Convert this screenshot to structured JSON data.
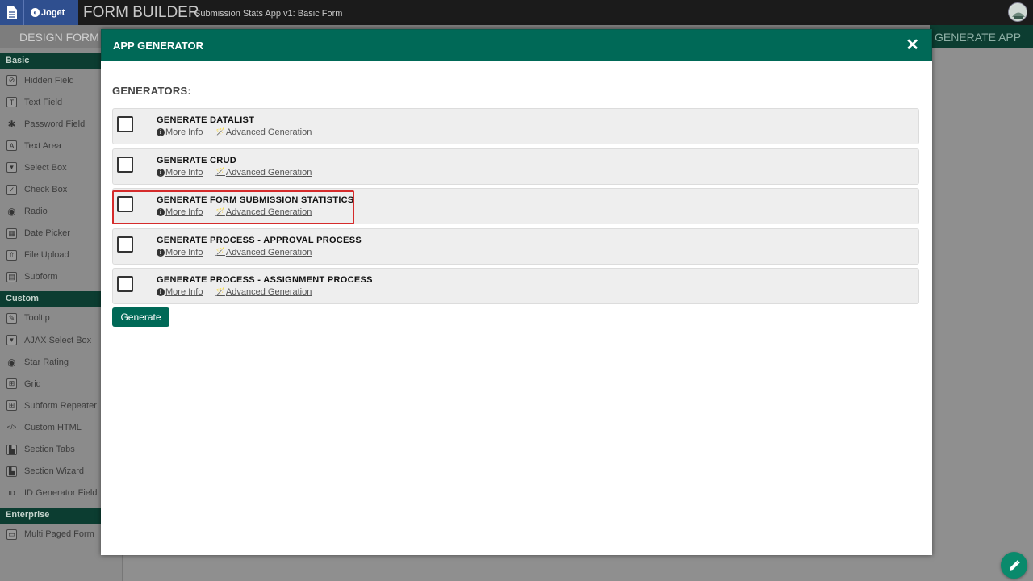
{
  "header": {
    "logo_text": "Joget",
    "title": "FORM BUILDER",
    "subtitle": "Submission Stats App v1: Basic Form"
  },
  "tabs": {
    "design": "DESIGN FORM",
    "generate": "GENERATE APP"
  },
  "palette": {
    "basic_title": "Basic",
    "basic_items": [
      {
        "label": "Hidden Field",
        "icon": "eye-slash-icon"
      },
      {
        "label": "Text Field",
        "icon": "text-field-icon"
      },
      {
        "label": "Password Field",
        "icon": "asterisk-icon"
      },
      {
        "label": "Text Area",
        "icon": "text-area-icon"
      },
      {
        "label": "Select Box",
        "icon": "select-box-icon"
      },
      {
        "label": "Check Box",
        "icon": "check-box-icon"
      },
      {
        "label": "Radio",
        "icon": "radio-icon"
      },
      {
        "label": "Date Picker",
        "icon": "calendar-icon"
      },
      {
        "label": "File Upload",
        "icon": "upload-icon"
      },
      {
        "label": "Subform",
        "icon": "subform-icon"
      }
    ],
    "custom_title": "Custom",
    "custom_items": [
      {
        "label": "Tooltip",
        "icon": "edit-icon"
      },
      {
        "label": "AJAX Select Box",
        "icon": "select-box-icon"
      },
      {
        "label": "Star Rating",
        "icon": "radio-icon"
      },
      {
        "label": "Grid",
        "icon": "grid-icon"
      },
      {
        "label": "Subform Repeater",
        "icon": "grid-icon"
      },
      {
        "label": "Custom HTML",
        "icon": "code-icon"
      },
      {
        "label": "Section Tabs",
        "icon": "tabs-icon"
      },
      {
        "label": "Section Wizard",
        "icon": "tabs-icon"
      },
      {
        "label": "ID Generator Field",
        "icon": "id-icon"
      }
    ],
    "enterprise_title": "Enterprise",
    "enterprise_items": [
      {
        "label": "Multi Paged Form",
        "icon": "form-icon"
      }
    ]
  },
  "modal": {
    "title": "APP GENERATOR",
    "generators_label": "GENERATORS:",
    "more_info": "More Info",
    "advanced": "Advanced Generation",
    "generate_button": "Generate",
    "generators": [
      {
        "name": "GENERATE DATALIST",
        "checked": false
      },
      {
        "name": "GENERATE CRUD",
        "checked": false
      },
      {
        "name": "GENERATE FORM SUBMISSION STATISTICS",
        "checked": false
      },
      {
        "name": "GENERATE PROCESS - APPROVAL PROCESS",
        "checked": false
      },
      {
        "name": "GENERATE PROCESS - ASSIGNMENT PROCESS",
        "checked": false
      }
    ]
  },
  "colors": {
    "accent": "#006957",
    "highlight": "#d52b2b"
  }
}
